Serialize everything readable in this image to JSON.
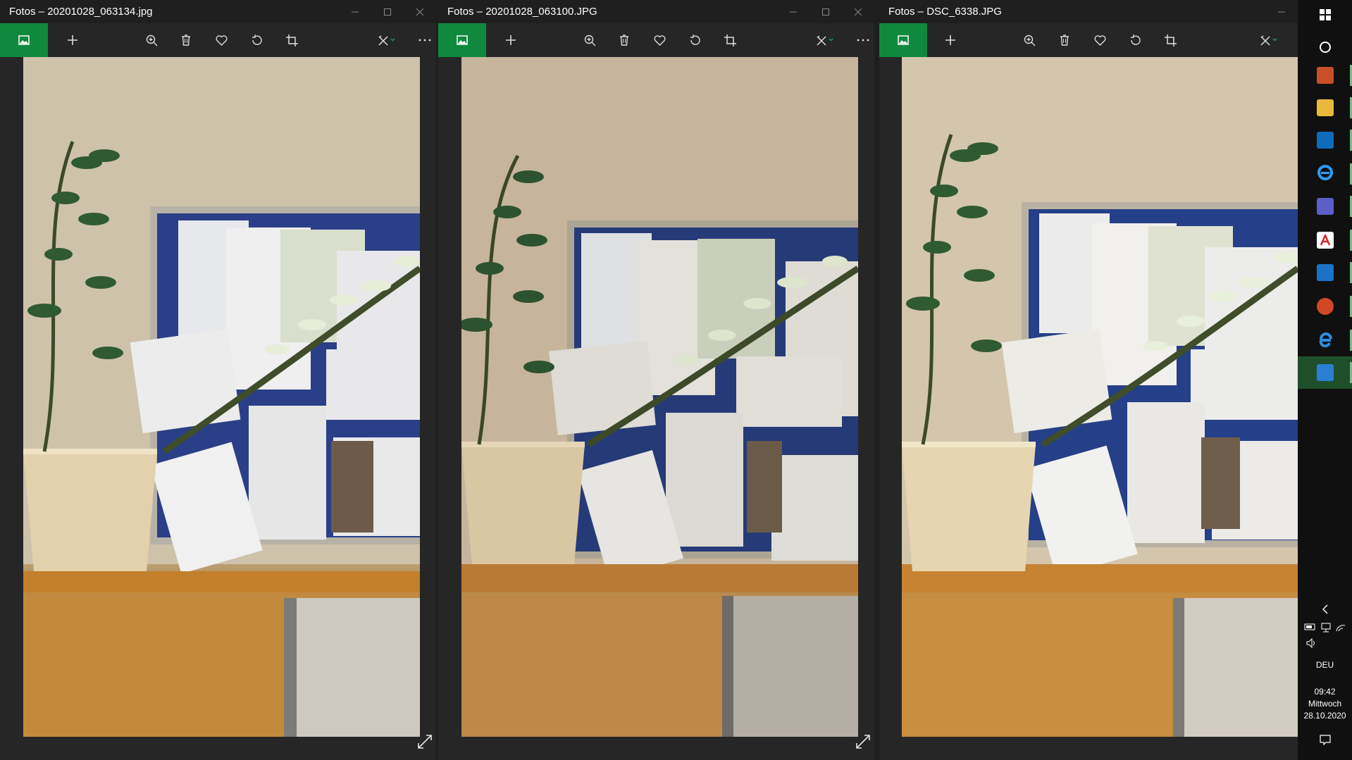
{
  "windows": [
    {
      "title": "Fotos – 20201028_063134.jpg"
    },
    {
      "title": "Fotos – 20201028_063100.JPG"
    },
    {
      "title": "Fotos – DSC_6338.JPG"
    }
  ],
  "icons": {
    "gallery": "gallery-icon",
    "add": "plus-icon",
    "zoom": "zoom-in-icon",
    "delete": "trash-icon",
    "favorite": "heart-icon",
    "rotate": "rotate-icon",
    "crop": "crop-icon",
    "edit": "edit-create-icon",
    "more": "more-icon",
    "expand": "expand-icon"
  },
  "colors": {
    "accent": "#10893e",
    "titlebar": "#1f1f1f",
    "taskbar": "#101010"
  },
  "taskbar": {
    "language": "DEU",
    "time": "09:42",
    "weekday": "Mittwoch",
    "date": "28.10.2020"
  }
}
